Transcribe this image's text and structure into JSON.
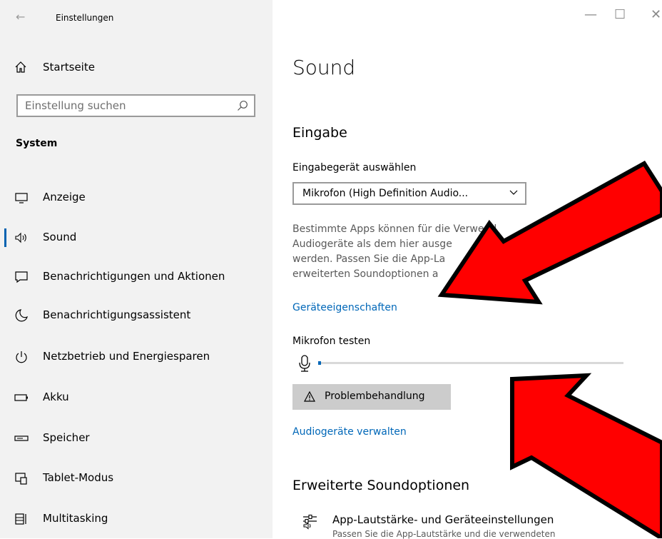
{
  "window": {
    "title": "Einstellungen",
    "back_glyph": "←"
  },
  "sidebar": {
    "home_label": "Startseite",
    "search_placeholder": "Einstellung suchen",
    "section_title": "System",
    "items": [
      {
        "label": "Anzeige",
        "icon": "monitor-icon"
      },
      {
        "label": "Sound",
        "icon": "speaker-icon",
        "selected": true
      },
      {
        "label": "Benachrichtigungen und Aktionen",
        "icon": "notification-icon"
      },
      {
        "label": "Benachrichtigungsassistent",
        "icon": "moon-icon"
      },
      {
        "label": "Netzbetrieb und Energiesparen",
        "icon": "power-icon"
      },
      {
        "label": "Akku",
        "icon": "battery-icon"
      },
      {
        "label": "Speicher",
        "icon": "storage-icon"
      },
      {
        "label": "Tablet-Modus",
        "icon": "tablet-mode-icon"
      },
      {
        "label": "Multitasking",
        "icon": "multitasking-icon"
      }
    ]
  },
  "controls": {
    "minimize": "—",
    "maximize": "☐",
    "close": "✕"
  },
  "main": {
    "page_title": "Sound",
    "input_heading": "Eingabe",
    "device_label": "Eingabegerät auswählen",
    "device_value": "Mikrofon (High Definition Audio...",
    "description_lines": [
      "Bestimmte Apps können für die Verwend",
      "Audiogeräte als dem hier ausge",
      "werden. Passen Sie die App-La                       äte in den",
      "erweiterten Soundoptionen a"
    ],
    "device_properties_link": "Geräteeigenschaften",
    "test_label": "Mikrofon testen",
    "mic_level_percent": 1,
    "troubleshoot_label": "Problembehandlung",
    "manage_devices_link": "Audiogeräte verwalten",
    "advanced_heading": "Erweiterte Soundoptionen",
    "app_volume_title": "App-Lautstärke- und Geräteeinstellungen",
    "app_volume_subtitle": "Passen Sie die App-Lautstärke und die verwendeten"
  },
  "colors": {
    "accent": "#0067b8",
    "arrow_fill": "#ff0000",
    "arrow_stroke": "#000000"
  }
}
